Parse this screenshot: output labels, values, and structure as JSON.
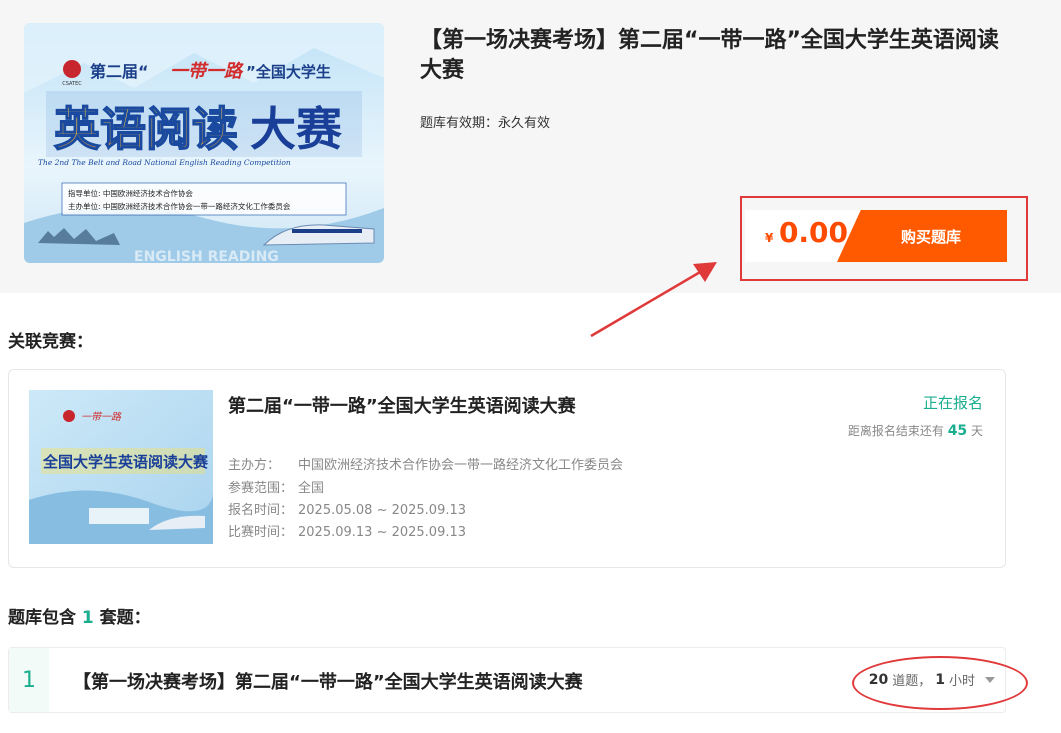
{
  "product": {
    "title": "【第一场决赛考场】第二届“一带一路”全国大学生英语阅读大赛",
    "validity_label": "题库有效期：",
    "validity_value": "永久有效",
    "price_currency": "¥",
    "price_amount": "0.00",
    "buy_label": "购买题库",
    "cover": {
      "logo_text": "CSATEC",
      "line1_prefix": "第二届“",
      "line1_script": "一带一路",
      "line1_suffix": "”全国大学生",
      "headline_a": "英语阅读",
      "headline_b": "大赛",
      "subtitle_en": "The 2nd The Belt and Road National English Reading Competition",
      "guide_unit": "指导单位: 中国欧洲经济技术合作协会",
      "host_unit": "主办单位: 中国欧洲经济技术合作协会一带一路经济文化工作委员会",
      "watermark": "ENGLISH READING"
    }
  },
  "related": {
    "section_title": "关联竞赛：",
    "name": "第二届“一带一路”全国大学生英语阅读大赛",
    "status": "正在报名",
    "remain_prefix": "距离报名结束还有 ",
    "remain_days": "45",
    "remain_suffix": " 天",
    "organizer_label": "主办方：",
    "organizer_value": "中国欧洲经济技术合作协会一带一路经济文化工作委员会",
    "scope_label": "参赛范围：",
    "scope_value": "全国",
    "signup_label": "报名时间：",
    "signup_value": "2025.05.08 ~ 2025.09.13",
    "match_label": "比赛时间：",
    "match_value": "2025.09.13 ~ 2025.09.13",
    "thumb_text": "全国大学生英语阅读大赛"
  },
  "sets": {
    "title_prefix": "题库包含 ",
    "count": "1",
    "title_suffix": " 套题：",
    "items": [
      {
        "index": "1",
        "name": "【第一场决赛考场】第二届“一带一路”全国大学生英语阅读大赛",
        "questions": "20",
        "questions_unit": "道题，",
        "hours": "1",
        "hours_unit": "小时"
      }
    ]
  },
  "colors": {
    "accent": "#1aae8f",
    "buy": "#ff5a00",
    "price": "#ff4b00",
    "highlight": "#e0393a"
  }
}
